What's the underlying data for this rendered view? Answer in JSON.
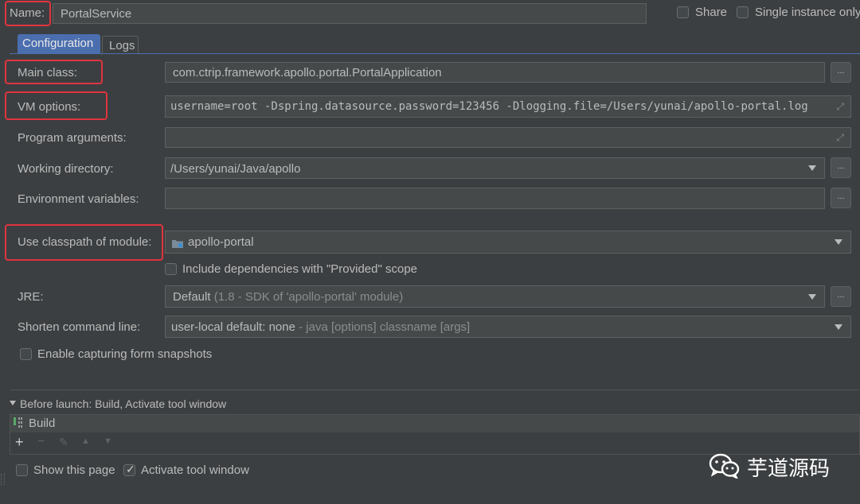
{
  "header": {
    "name_label": "Name:",
    "name_value": "PortalService",
    "share_label": "Share",
    "single_instance_label": "Single instance only"
  },
  "tabs": [
    {
      "label": "Configuration",
      "selected": true
    },
    {
      "label": "Logs",
      "selected": false
    }
  ],
  "form": {
    "main_class": {
      "label": "Main class:",
      "value": "com.ctrip.framework.apollo.portal.PortalApplication",
      "button": "..."
    },
    "vm_options": {
      "label": "VM options:",
      "value": "username=root -Dspring.datasource.password=123456 -Dlogging.file=/Users/yunai/apollo-portal.log"
    },
    "program_arguments": {
      "label": "Program arguments:",
      "value": ""
    },
    "working_directory": {
      "label": "Working directory:",
      "value": "/Users/yunai/Java/apollo",
      "button": "..."
    },
    "environment_variables": {
      "label": "Environment variables:",
      "value": "",
      "button": "..."
    },
    "classpath_module": {
      "label": "Use classpath of module:",
      "value": "apollo-portal"
    },
    "include_dependencies": {
      "label": "Include dependencies with \"Provided\" scope",
      "checked": false
    },
    "jre": {
      "label": "JRE:",
      "value": "Default",
      "hint": "(1.8 - SDK of 'apollo-portal' module)",
      "button": "..."
    },
    "shorten_command_line": {
      "label": "Shorten command line:",
      "value": "user-local default: none",
      "hint": "- java [options] classname [args]"
    },
    "capture_snapshots": {
      "label": "Enable capturing form snapshots",
      "checked": false
    }
  },
  "before_launch": {
    "title": "Before launch: Build, Activate tool window",
    "items": [
      "Build"
    ],
    "toolbar": [
      "+",
      "−",
      "✎",
      "▲",
      "▼"
    ]
  },
  "footer": {
    "show_page": {
      "label": "Show this page",
      "checked": false
    },
    "activate_tool_window": {
      "label": "Activate tool window",
      "checked": true
    }
  },
  "watermark": {
    "text": "芋道源码"
  },
  "colors": {
    "background": "#3c3f41",
    "field": "#45494a",
    "highlight_box": "#e0343f",
    "tab_selected": "#4b6eaf"
  }
}
